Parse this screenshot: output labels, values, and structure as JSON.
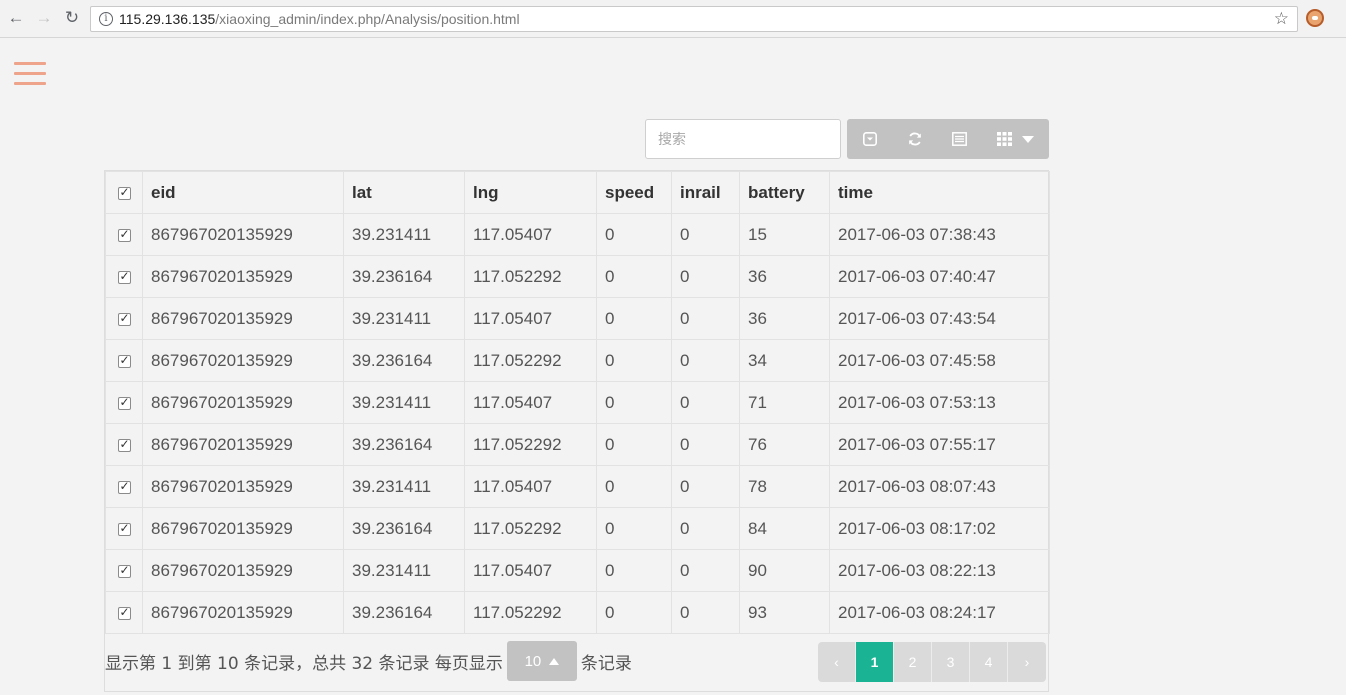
{
  "browser": {
    "url_host": "115.29.136.135",
    "url_path": "/xiaoxing_admin/index.php/Analysis/position.html",
    "back_icon": "←",
    "forward_icon": "→",
    "reload_icon": "↻",
    "info_icon": "i",
    "star_icon": "☆"
  },
  "toolbar": {
    "search_placeholder": "搜索"
  },
  "table": {
    "columns": [
      "eid",
      "lat",
      "lng",
      "speed",
      "inrail",
      "battery",
      "time"
    ],
    "rows": [
      [
        "867967020135929",
        "39.231411",
        "117.05407",
        "0",
        "0",
        "15",
        "2017-06-03 07:38:43"
      ],
      [
        "867967020135929",
        "39.236164",
        "117.052292",
        "0",
        "0",
        "36",
        "2017-06-03 07:40:47"
      ],
      [
        "867967020135929",
        "39.231411",
        "117.05407",
        "0",
        "0",
        "36",
        "2017-06-03 07:43:54"
      ],
      [
        "867967020135929",
        "39.236164",
        "117.052292",
        "0",
        "0",
        "34",
        "2017-06-03 07:45:58"
      ],
      [
        "867967020135929",
        "39.231411",
        "117.05407",
        "0",
        "0",
        "71",
        "2017-06-03 07:53:13"
      ],
      [
        "867967020135929",
        "39.236164",
        "117.052292",
        "0",
        "0",
        "76",
        "2017-06-03 07:55:17"
      ],
      [
        "867967020135929",
        "39.231411",
        "117.05407",
        "0",
        "0",
        "78",
        "2017-06-03 08:07:43"
      ],
      [
        "867967020135929",
        "39.236164",
        "117.052292",
        "0",
        "0",
        "84",
        "2017-06-03 08:17:02"
      ],
      [
        "867967020135929",
        "39.231411",
        "117.05407",
        "0",
        "0",
        "90",
        "2017-06-03 08:22:13"
      ],
      [
        "867967020135929",
        "39.236164",
        "117.052292",
        "0",
        "0",
        "93",
        "2017-06-03 08:24:17"
      ]
    ]
  },
  "pagination": {
    "info_text": "显示第 1 到第 10 条记录，总共 32 条记录 每页显示",
    "page_size": "10",
    "suffix_text": "条记录",
    "prev": "‹",
    "pages": [
      "1",
      "2",
      "3",
      "4"
    ],
    "next": "›",
    "active_page": "1",
    "active_color": "#1ab394"
  }
}
